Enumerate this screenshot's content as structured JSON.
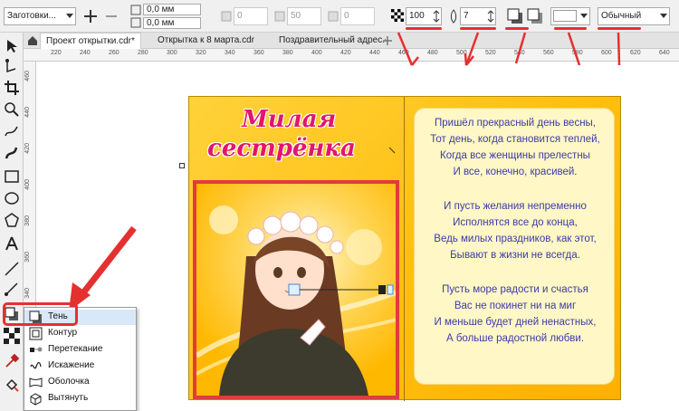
{
  "property_bar": {
    "preset_label": "Заготовки...",
    "pos_x": "0,0 мм",
    "pos_y": "0,0 мм",
    "field_a": "0",
    "field_b": "50",
    "field_c": "0",
    "opacity": "100",
    "feather": "7",
    "shadow_color_swatch": "#ffffff",
    "merge_mode": "Обычный"
  },
  "tabs": [
    {
      "label": "Проект открытки.cdr*"
    },
    {
      "label": "Открытка к 8 марта.cdr"
    },
    {
      "label": "Поздравительный адрес.cdr"
    }
  ],
  "hruler_ticks": [
    "220",
    "240",
    "260",
    "280",
    "300",
    "320",
    "340",
    "360",
    "380",
    "400",
    "420",
    "440",
    "460",
    "480",
    "500",
    "520",
    "540",
    "560",
    "580",
    "600",
    "620",
    "640"
  ],
  "vruler_ticks": [
    "460",
    "440",
    "420",
    "400",
    "380",
    "360",
    "340",
    "320",
    "300"
  ],
  "card": {
    "title_line1": "Милая",
    "title_line2": "сестрёнка",
    "poem": [
      "Пришёл прекрасный день весны,",
      "Тот день, когда становится теплей,",
      "Когда все женщины прелестны",
      "И все, конечно, красивей.",
      "",
      "И пусть желания непременно",
      "Исполнятся все до конца,",
      "Ведь милых праздников, как этот,",
      "Бывают в жизни не всегда.",
      "",
      "Пусть море радости и счастья",
      "Вас не покинет ни на миг",
      "И меньше будет дней ненастных,",
      "А больше радостной любви."
    ]
  },
  "flyout": {
    "items": [
      {
        "label": "Тень",
        "icon": "drop-shadow-icon"
      },
      {
        "label": "Контур",
        "icon": "contour-icon"
      },
      {
        "label": "Перетекание",
        "icon": "blend-icon"
      },
      {
        "label": "Искажение",
        "icon": "distort-icon"
      },
      {
        "label": "Оболочка",
        "icon": "envelope-icon"
      },
      {
        "label": "Вытянуть",
        "icon": "extrude-icon"
      }
    ]
  },
  "colors": {
    "highlight": "#e53030",
    "poem_text": "#3b3ba8",
    "title": "#e0166e",
    "card_bg": "#ffbf10"
  }
}
